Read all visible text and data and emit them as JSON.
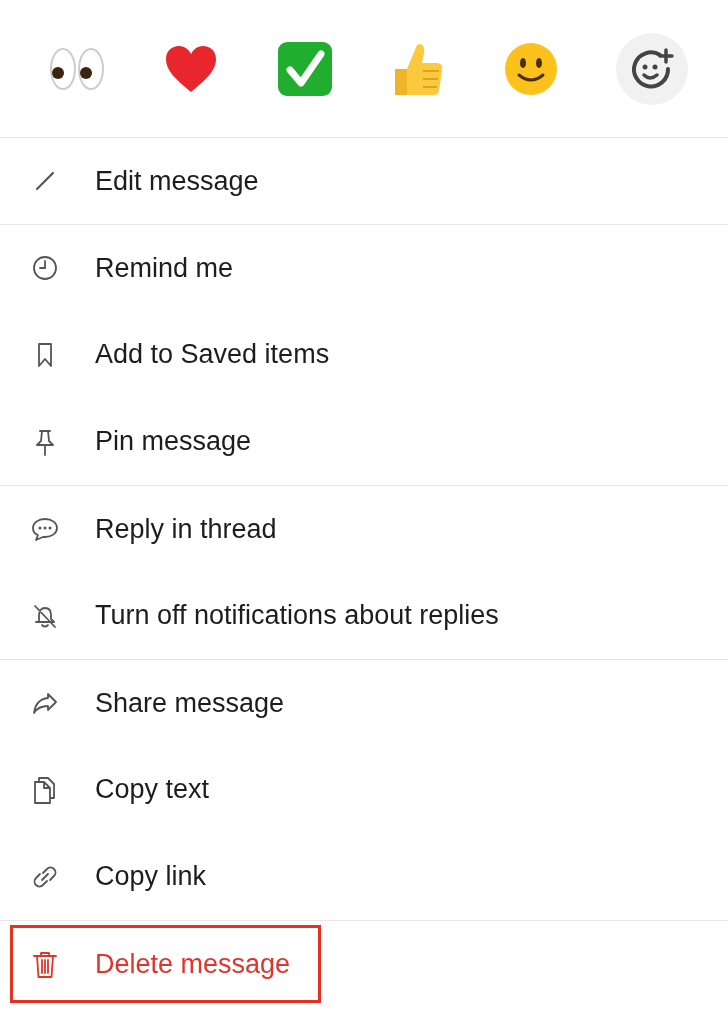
{
  "reactions": [
    {
      "kind": "eyes"
    },
    {
      "kind": "heart"
    },
    {
      "kind": "check"
    },
    {
      "kind": "thumbs"
    },
    {
      "kind": "smile"
    },
    {
      "kind": "add"
    }
  ],
  "groups": [
    {
      "items": [
        {
          "kind": "pencil",
          "label": "Edit message",
          "danger": false,
          "highlighted": false
        }
      ]
    },
    {
      "items": [
        {
          "kind": "clock",
          "label": "Remind me",
          "danger": false,
          "highlighted": false
        },
        {
          "kind": "bookmark",
          "label": "Add to Saved items",
          "danger": false,
          "highlighted": false
        },
        {
          "kind": "pin",
          "label": "Pin message",
          "danger": false,
          "highlighted": false
        }
      ]
    },
    {
      "items": [
        {
          "kind": "bubble",
          "label": "Reply in thread",
          "danger": false,
          "highlighted": false
        },
        {
          "kind": "bell-off",
          "label": "Turn off notifications about replies",
          "danger": false,
          "highlighted": false
        }
      ]
    },
    {
      "items": [
        {
          "kind": "share",
          "label": "Share message",
          "danger": false,
          "highlighted": false
        },
        {
          "kind": "copy",
          "label": "Copy text",
          "danger": false,
          "highlighted": false
        },
        {
          "kind": "link",
          "label": "Copy link",
          "danger": false,
          "highlighted": false
        }
      ]
    },
    {
      "items": [
        {
          "kind": "trash",
          "label": "Delete message",
          "danger": true,
          "highlighted": true
        }
      ]
    }
  ]
}
